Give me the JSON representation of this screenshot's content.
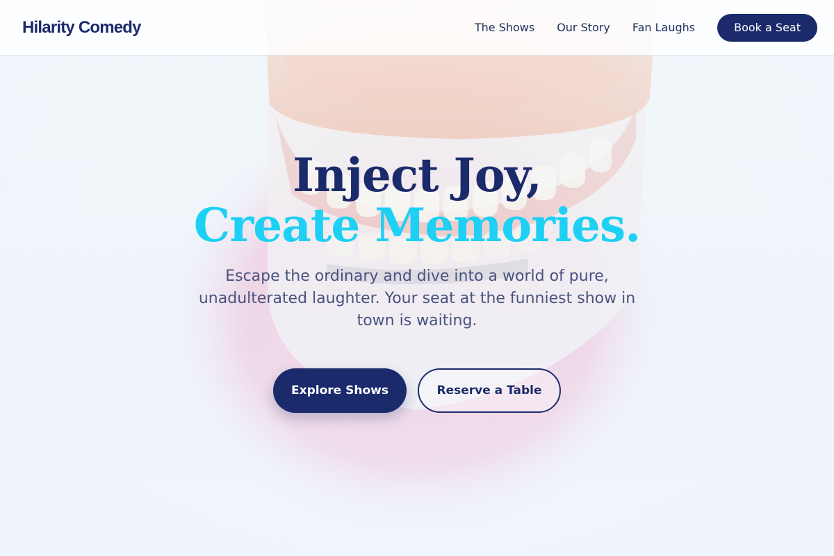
{
  "header": {
    "logo": "Hilarity Comedy",
    "nav": [
      {
        "label": "The Shows"
      },
      {
        "label": "Our Story"
      },
      {
        "label": "Fan Laughs"
      }
    ],
    "cta": "Book a Seat"
  },
  "hero": {
    "headline_line1": "Inject Joy,",
    "headline_line2": "Create Memories.",
    "subtext": "Escape the ordinary and dive into a world of pure, unadulterated laughter. Your seat at the funniest show in town is waiting.",
    "primary_button": "Explore Shows",
    "secondary_button": "Reserve a Table"
  },
  "colors": {
    "brand_navy": "#1b2a6b",
    "accent_cyan": "#1ed0f4",
    "body_text": "#4a5280",
    "background": "#eef4fa"
  }
}
